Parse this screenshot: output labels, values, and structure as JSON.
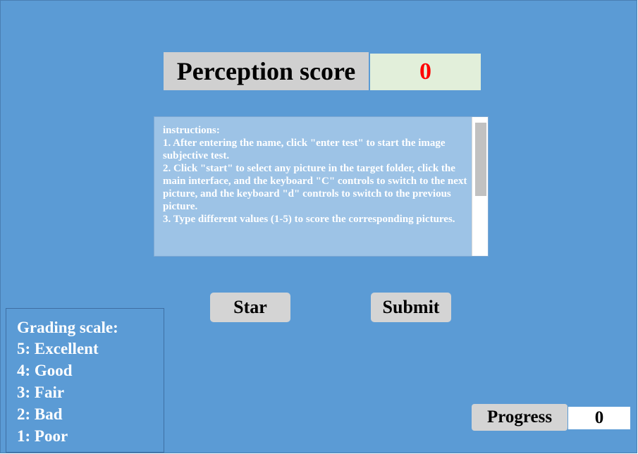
{
  "perception": {
    "label": "Perception score",
    "value": "0"
  },
  "instructions": {
    "text": "instructions:\n1. After entering the name, click \"enter test\" to start the image subjective test.\n2. Click \"start\" to select any picture in the target folder, click the main interface, and the keyboard \"C\" controls to switch to the next picture, and the keyboard \"d\" controls to switch to the previous picture.\n3. Type different values (1-5) to score the corresponding pictures."
  },
  "buttons": {
    "star_label": "Star",
    "submit_label": "Submit"
  },
  "grading": {
    "title": "Grading scale:",
    "items": [
      "5: Excellent",
      "4: Good",
      "3: Fair",
      "2: Bad",
      "1: Poor"
    ]
  },
  "progress": {
    "label": "Progress",
    "value": "0"
  },
  "colors": {
    "background": "#5b9bd5",
    "score_value": "#ff0000",
    "score_box": "#e2efda",
    "instructions_box": "#9dc3e6"
  }
}
